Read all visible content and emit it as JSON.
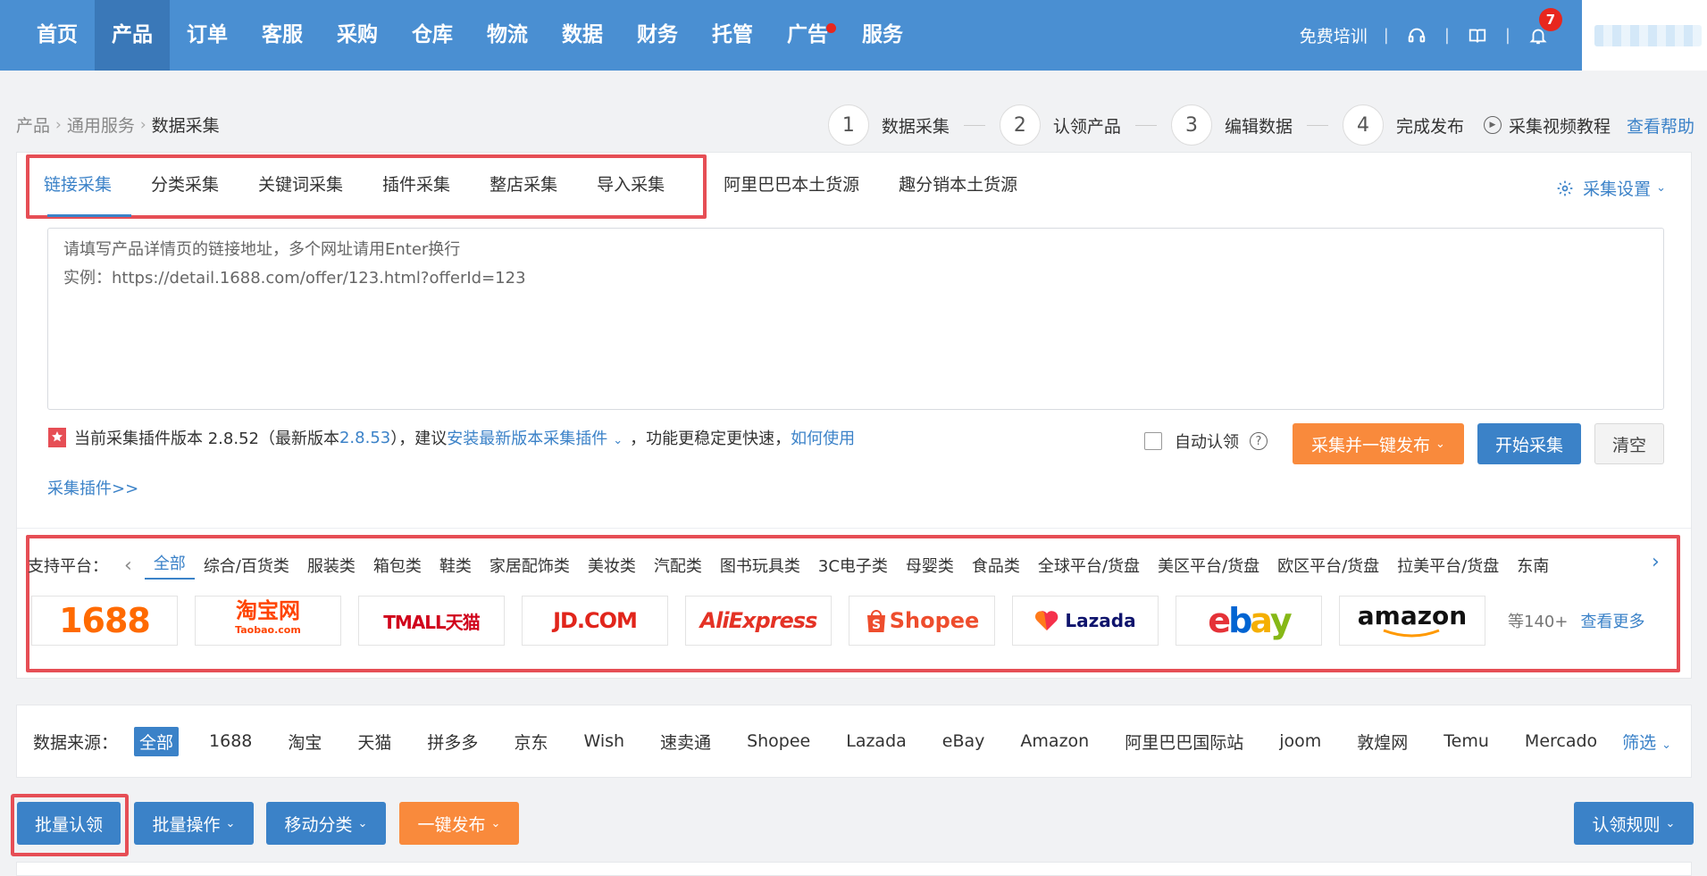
{
  "nav": {
    "items": [
      {
        "label": "首页",
        "active": false,
        "dot": false
      },
      {
        "label": "产品",
        "active": true,
        "dot": false
      },
      {
        "label": "订单",
        "active": false,
        "dot": false
      },
      {
        "label": "客服",
        "active": false,
        "dot": false
      },
      {
        "label": "采购",
        "active": false,
        "dot": false
      },
      {
        "label": "仓库",
        "active": false,
        "dot": false
      },
      {
        "label": "物流",
        "active": false,
        "dot": false
      },
      {
        "label": "数据",
        "active": false,
        "dot": false
      },
      {
        "label": "财务",
        "active": false,
        "dot": false
      },
      {
        "label": "托管",
        "active": false,
        "dot": false
      },
      {
        "label": "广告",
        "active": false,
        "dot": true
      },
      {
        "label": "服务",
        "active": false,
        "dot": false
      }
    ],
    "training": "免费培训",
    "notification_count": "7",
    "icons": [
      "headset-icon",
      "book-icon",
      "bell-icon"
    ]
  },
  "breadcrumb": {
    "items": [
      "产品",
      "通用服务"
    ],
    "current": "数据采集"
  },
  "steps": [
    {
      "num": "1",
      "label": "数据采集"
    },
    {
      "num": "2",
      "label": "认领产品"
    },
    {
      "num": "3",
      "label": "编辑数据"
    },
    {
      "num": "4",
      "label": "完成发布"
    }
  ],
  "tutorial": "采集视频教程",
  "help": "查看帮助",
  "tabs": {
    "boxed": [
      "链接采集",
      "分类采集",
      "关键词采集",
      "插件采集",
      "整店采集",
      "导入采集"
    ],
    "extra": [
      "阿里巴巴本土货源",
      "趣分销本土货源"
    ],
    "active": 0,
    "settings_label": "采集设置"
  },
  "link_input": {
    "placeholder_line1": "请填写产品详情页的链接地址，多个网址请用Enter换行",
    "placeholder_line2": "实例：https://detail.1688.com/offer/123.html?offerId=123"
  },
  "plugin_notice": {
    "prefix": "当前采集插件版本 2.8.52（最新版本 ",
    "latest": "2.8.53",
    "mid": "），建议 ",
    "install_link": "安装最新版本采集插件",
    "suffix": "，功能更稳定更快速，",
    "howto": "如何使用",
    "plugin_link": "采集插件>>"
  },
  "actions": {
    "auto_claim": "自动认领",
    "collect_publish": "采集并一键发布",
    "start": "开始采集",
    "clear": "清空"
  },
  "platforms": {
    "label": "支持平台：",
    "categories": [
      "全部",
      "综合/百货类",
      "服装类",
      "箱包类",
      "鞋类",
      "家居配饰类",
      "美妆类",
      "汽配类",
      "图书玩具类",
      "3C电子类",
      "母婴类",
      "食品类",
      "全球平台/货盘",
      "美区平台/货盘",
      "欧区平台/货盘",
      "拉美平台/货盘",
      "东南"
    ],
    "active": 0,
    "logos": [
      {
        "name": "1688",
        "text": "1688"
      },
      {
        "name": "taobao",
        "text": "淘宝网",
        "sub": "Taobao.com"
      },
      {
        "name": "tmall",
        "text": "TMALL天猫"
      },
      {
        "name": "jd",
        "text": "JD.COM"
      },
      {
        "name": "aliexpress",
        "text": "AliExpress"
      },
      {
        "name": "shopee",
        "text": "Shopee"
      },
      {
        "name": "lazada",
        "text": "Lazada"
      },
      {
        "name": "ebay",
        "text": "ebay"
      },
      {
        "name": "amazon",
        "text": "amazon"
      }
    ],
    "more_count": "等140+",
    "more_link": "查看更多"
  },
  "data_source": {
    "label": "数据来源：",
    "items": [
      "全部",
      "1688",
      "淘宝",
      "天猫",
      "拼多多",
      "京东",
      "Wish",
      "速卖通",
      "Shopee",
      "Lazada",
      "eBay",
      "Amazon",
      "阿里巴巴国际站",
      "joom",
      "敦煌网",
      "Temu",
      "Mercado"
    ],
    "active": 0,
    "filter": "筛选"
  },
  "bottom_actions": {
    "batch_claim": "批量认领",
    "batch_ops": "批量操作",
    "move_category": "移动分类",
    "one_click_publish": "一键发布",
    "claim_rules": "认领规则"
  },
  "colors": {
    "nav_bg": "#4a8fd2",
    "primary": "#3b82c8",
    "orange": "#f98a3c",
    "highlight": "#e64e55"
  }
}
